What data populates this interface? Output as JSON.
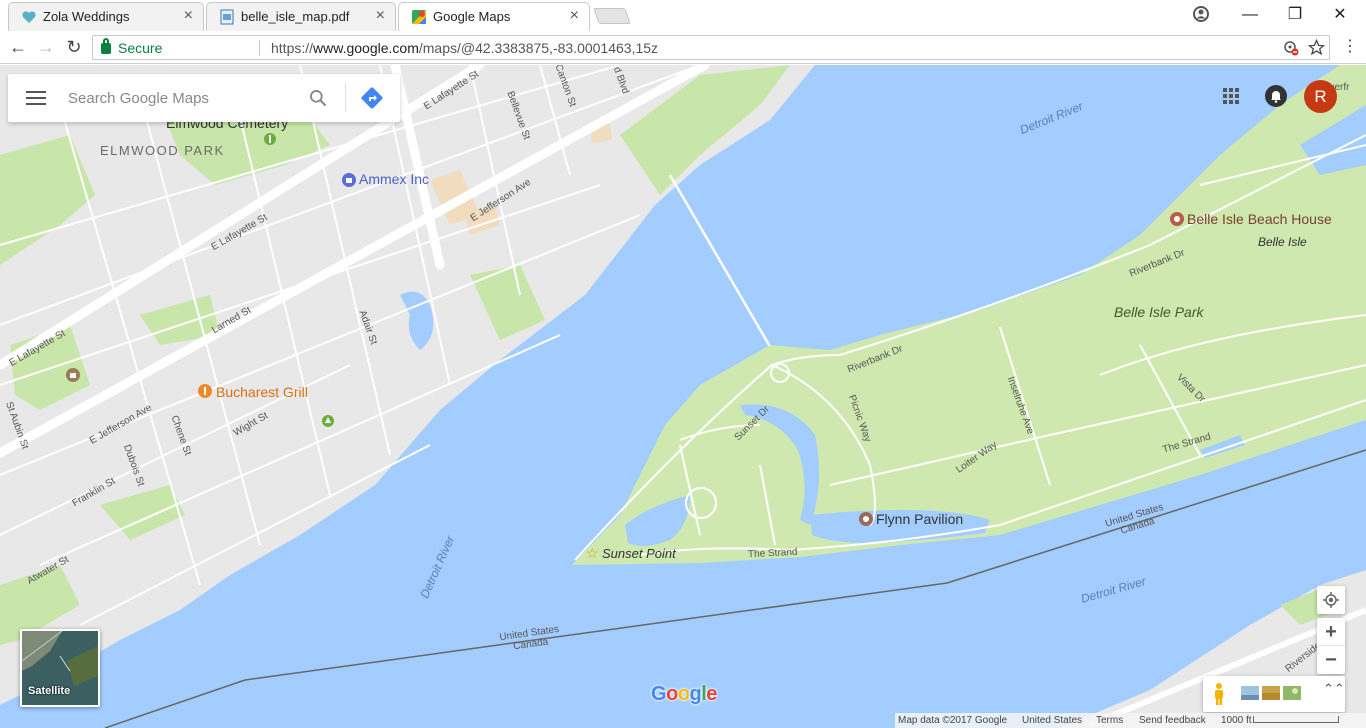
{
  "browser": {
    "tabs": [
      {
        "title": "Zola Weddings",
        "icon": "heart-icon",
        "close": "×"
      },
      {
        "title": "belle_isle_map.pdf",
        "icon": "pdf-doc-icon",
        "close": "×"
      },
      {
        "title": "Google Maps",
        "icon": "google-maps-icon",
        "close": "×"
      }
    ],
    "active_tab": 2,
    "window_controls": {
      "minimize": "—",
      "restore": "❐",
      "close": "✕"
    },
    "nav": {
      "back": "←",
      "forward": "→",
      "reload": "↻"
    },
    "secure_label": "Secure",
    "url_scheme": "https://",
    "url_host": "www.google.com",
    "url_path": "/maps/@42.3383875,-83.0001463,15z",
    "menu": "⋮"
  },
  "maps": {
    "search_placeholder": "Search Google Maps",
    "avatar_letter": "R",
    "zoom_in": "+",
    "zoom_out": "−",
    "satellite_label": "Satellite",
    "logo": [
      "G",
      "o",
      "o",
      "g",
      "l",
      "e"
    ],
    "logo_colors": [
      "#4285f4",
      "#ea4335",
      "#fbbc05",
      "#4285f4",
      "#34a853",
      "#ea4335"
    ],
    "expand": "⌃⌃",
    "footer": {
      "map_data": "Map data ©2017 Google",
      "country": "United States",
      "terms": "Terms",
      "feedback": "Send feedback",
      "scale": "1000 ft"
    },
    "labels": {
      "elmwood_cemetery": "Elmwood Cemetery",
      "elmwood_park": "ELMWOOD PARK",
      "ammex": "Ammex Inc",
      "bucharest": "Bucharest Grill",
      "beach_house": "Belle Isle Beach House",
      "belle_isle": "Belle Isle",
      "belle_isle_park": "Belle Isle Park",
      "flynn": "Flynn Pavilion",
      "sunset_point": "Sunset Point",
      "detroit_river_1": "Detroit River",
      "detroit_river_2": "Detroit River",
      "detroit_river_3": "Detroit River",
      "us_1": "United States",
      "ca_1": "Canada",
      "us_2": "United States",
      "ca_2": "Canada",
      "e_lafayette_1": "E Lafayette St",
      "e_lafayette_2": "E Lafayette St",
      "e_lafayette_3": "E Lafayette St",
      "bellevue": "Bellevue St",
      "canton": "Canton St",
      "blvd": "d Blvd",
      "e_jefferson_1": "E Jefferson Ave",
      "e_jefferson_2": "E Jefferson Ave",
      "larned": "Larned St",
      "adair": "Adair St",
      "wight": "Wight St",
      "chene": "Chene St",
      "dubois": "Dubois St",
      "franklin": "Franklin St",
      "st_aubin": "St Aubin St",
      "atwater": "Atwater St",
      "riverbank_1": "Riverbank Dr",
      "riverbank_2": "Riverbank Dr",
      "picnic": "Picnic Way",
      "sunset_dr": "Sunset Dr",
      "loiter": "Loiter Way",
      "inselruhe": "Inselruhe Ave",
      "vista": "Vista Dr",
      "the_strand_1": "The Strand",
      "the_strand_2": "The Strand",
      "riverside": "Riverside Dr E",
      "riverf": "Riverfr"
    }
  }
}
